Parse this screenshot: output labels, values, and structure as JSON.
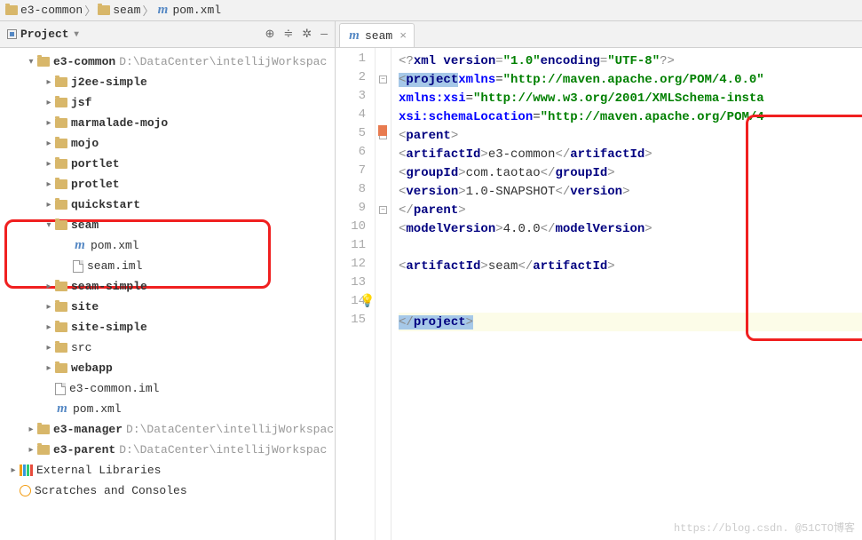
{
  "breadcrumb": {
    "root": "e3-common",
    "mid": "seam",
    "file": "pom.xml"
  },
  "sidebar": {
    "title": "Project",
    "items": [
      {
        "indent": 0,
        "arrow": "▾",
        "icon": "folder",
        "label": "e3-common",
        "bold": true,
        "path": "D:\\DataCenter\\intellijWorkspac"
      },
      {
        "indent": 1,
        "arrow": "▸",
        "icon": "folder",
        "label": "j2ee-simple",
        "bold": true
      },
      {
        "indent": 1,
        "arrow": "▸",
        "icon": "folder",
        "label": "jsf",
        "bold": true
      },
      {
        "indent": 1,
        "arrow": "▸",
        "icon": "folder",
        "label": "marmalade-mojo",
        "bold": true
      },
      {
        "indent": 1,
        "arrow": "▸",
        "icon": "folder",
        "label": "mojo",
        "bold": true
      },
      {
        "indent": 1,
        "arrow": "▸",
        "icon": "folder",
        "label": "portlet",
        "bold": true
      },
      {
        "indent": 1,
        "arrow": "▸",
        "icon": "folder",
        "label": "protlet",
        "bold": true
      },
      {
        "indent": 1,
        "arrow": "▸",
        "icon": "folder",
        "label": "quickstart",
        "bold": true
      },
      {
        "indent": 1,
        "arrow": "▾",
        "icon": "folder",
        "label": "seam",
        "bold": true
      },
      {
        "indent": 2,
        "arrow": "",
        "icon": "m",
        "label": "pom.xml"
      },
      {
        "indent": 2,
        "arrow": "",
        "icon": "file",
        "label": "seam.iml"
      },
      {
        "indent": 1,
        "arrow": "▸",
        "icon": "folder",
        "label": "seam-simple",
        "bold": true
      },
      {
        "indent": 1,
        "arrow": "▸",
        "icon": "folder",
        "label": "site",
        "bold": true
      },
      {
        "indent": 1,
        "arrow": "▸",
        "icon": "folder",
        "label": "site-simple",
        "bold": true
      },
      {
        "indent": 1,
        "arrow": "▸",
        "icon": "folder",
        "label": "src"
      },
      {
        "indent": 1,
        "arrow": "▸",
        "icon": "folder",
        "label": "webapp",
        "bold": true
      },
      {
        "indent": 1,
        "arrow": "",
        "icon": "file",
        "label": "e3-common.iml"
      },
      {
        "indent": 1,
        "arrow": "",
        "icon": "m",
        "label": "pom.xml"
      },
      {
        "indent": 0,
        "arrow": "▸",
        "icon": "folder",
        "label": "e3-manager",
        "bold": true,
        "path": "D:\\DataCenter\\intellijWorkspac"
      },
      {
        "indent": 0,
        "arrow": "▸",
        "icon": "folder",
        "label": "e3-parent",
        "bold": true,
        "path": "D:\\DataCenter\\intellijWorkspac"
      },
      {
        "indent": -1,
        "arrow": "▸",
        "icon": "lib",
        "label": "External Libraries"
      },
      {
        "indent": -1,
        "arrow": "",
        "icon": "clock",
        "label": "Scratches and Consoles"
      }
    ]
  },
  "tab": {
    "label": "seam",
    "close": "×"
  },
  "editor": {
    "lines": [
      {
        "n": 1,
        "html": "<span class='xml-decl'>&lt;?</span><span class='xml-tag'>xml version</span><span class='xml-decl'>=</span><span class='xml-val'>\"1.0\"</span> <span class='xml-tag'>encoding</span><span class='xml-decl'>=</span><span class='xml-val'>\"UTF-8\"</span><span class='xml-decl'>?&gt;</span>"
      },
      {
        "n": 2,
        "html": "<span class='sel'><span class='xml-decl'>&lt;</span><span class='xml-tag'>project</span></span> <span class='xml-attr'>xmlns</span>=<span class='xml-val'>\"http://maven.apache.org/POM/4.0.0\"</span>"
      },
      {
        "n": 3,
        "html": "         <span class='xml-attr'>xmlns:xsi</span>=<span class='xml-val'>\"http://www.w3.org/2001/XMLSchema-insta</span>"
      },
      {
        "n": 4,
        "html": "         <span class='xml-attr'>xsi:schemaLocation</span>=<span class='xml-val'>\"http://maven.apache.org/POM/4</span>"
      },
      {
        "n": 5,
        "html": "    <span class='xml-decl'>&lt;</span><span class='xml-tag'>parent</span><span class='xml-decl'>&gt;</span>"
      },
      {
        "n": 6,
        "html": "        <span class='xml-decl'>&lt;</span><span class='xml-tag'>artifactId</span><span class='xml-decl'>&gt;</span>e3-common<span class='xml-decl'>&lt;/</span><span class='xml-tag'>artifactId</span><span class='xml-decl'>&gt;</span>"
      },
      {
        "n": 7,
        "html": "        <span class='xml-decl'>&lt;</span><span class='xml-tag'>groupId</span><span class='xml-decl'>&gt;</span>com.taotao<span class='xml-decl'>&lt;/</span><span class='xml-tag'>groupId</span><span class='xml-decl'>&gt;</span>"
      },
      {
        "n": 8,
        "html": "        <span class='xml-decl'>&lt;</span><span class='xml-tag'>version</span><span class='xml-decl'>&gt;</span>1.0-SNAPSHOT<span class='xml-decl'>&lt;/</span><span class='xml-tag'>version</span><span class='xml-decl'>&gt;</span>"
      },
      {
        "n": 9,
        "html": "    <span class='xml-decl'>&lt;/</span><span class='xml-tag'>parent</span><span class='xml-decl'>&gt;</span>"
      },
      {
        "n": 10,
        "html": "    <span class='xml-decl'>&lt;</span><span class='xml-tag'>modelVersion</span><span class='xml-decl'>&gt;</span>4.0.0<span class='xml-decl'>&lt;/</span><span class='xml-tag'>modelVersion</span><span class='xml-decl'>&gt;</span>"
      },
      {
        "n": 11,
        "html": ""
      },
      {
        "n": 12,
        "html": "    <span class='xml-decl'>&lt;</span><span class='xml-tag'>artifactId</span><span class='xml-decl'>&gt;</span>seam<span class='xml-decl'>&lt;/</span><span class='xml-tag'>artifactId</span><span class='xml-decl'>&gt;</span>"
      },
      {
        "n": 13,
        "html": ""
      },
      {
        "n": 14,
        "html": ""
      },
      {
        "n": 15,
        "html": "<span class='sel'><span class='xml-decl'>&lt;/</span><span class='xml-tag'>project</span><span class='xml-decl'>&gt;</span></span>",
        "caret": true
      }
    ]
  },
  "watermark": "https://blog.csdn.  @51CTO博客"
}
